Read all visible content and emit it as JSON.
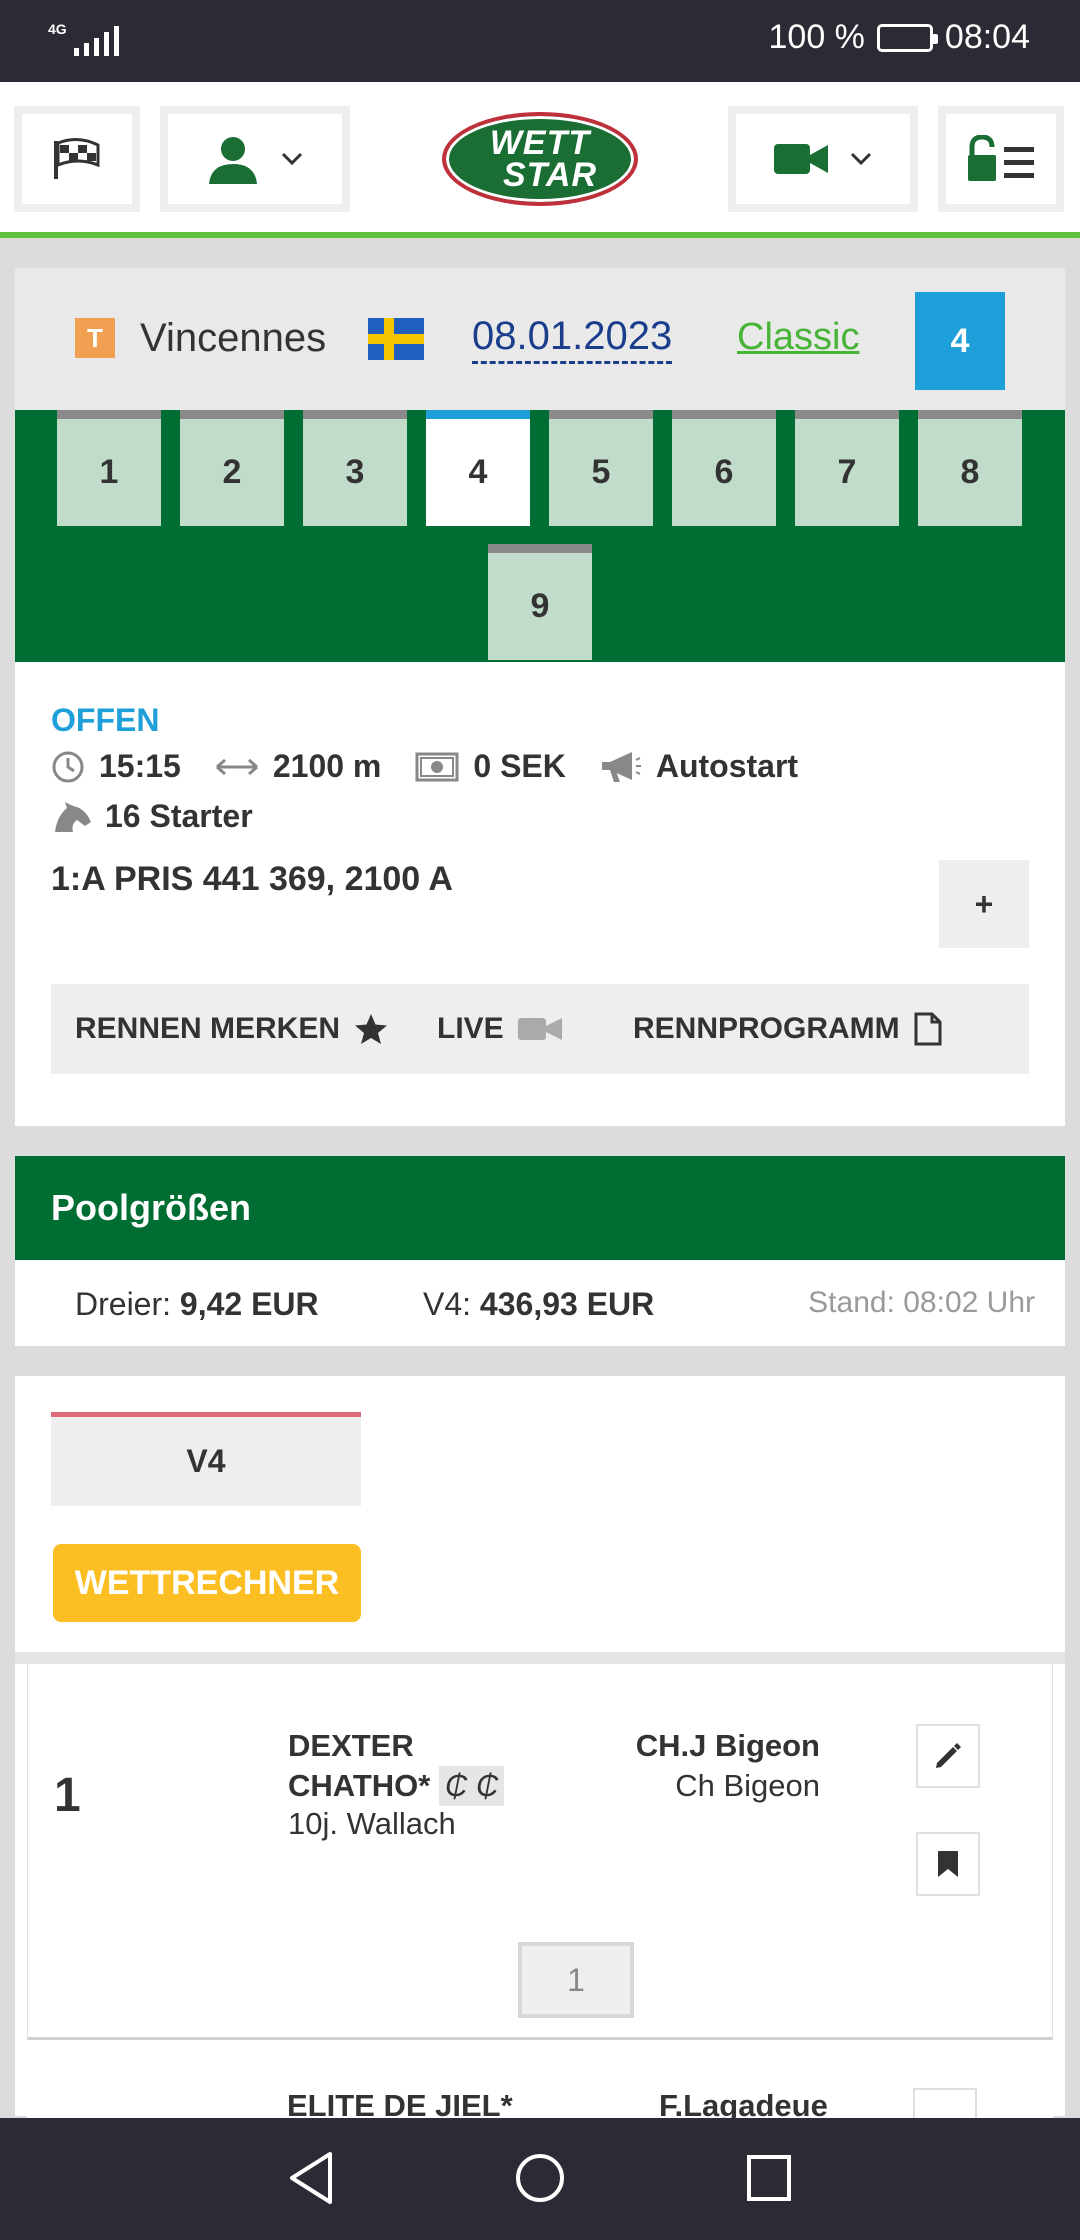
{
  "status_bar": {
    "network": "4G",
    "battery": "100 %",
    "time": "08:04"
  },
  "header": {
    "logo_line1": "WETT",
    "logo_line2": "STAR"
  },
  "race_header": {
    "type_badge": "T",
    "venue": "Vincennes",
    "date": "08.01.2023",
    "mode": "Classic",
    "race_number": "4"
  },
  "race_tabs": [
    "1",
    "2",
    "3",
    "4",
    "5",
    "6",
    "7",
    "8",
    "9"
  ],
  "race_info": {
    "status": "OFFEN",
    "time": "15:15",
    "distance": "2100 m",
    "prize": "0 SEK",
    "start_type": "Autostart",
    "starters": "16 Starter",
    "title": "1:A PRIS 441 369, 2100 A",
    "expand": "+",
    "actions": {
      "bookmark": "RENNEN MERKEN",
      "live": "LIVE",
      "program": "RENNPROGRAMM"
    }
  },
  "pool": {
    "title": "Poolgrößen",
    "dreier_label": "Dreier:",
    "dreier_value": "9,42 EUR",
    "v4_label": "V4:",
    "v4_value": "436,93 EUR",
    "stand": "Stand: 08:02 Uhr"
  },
  "bets": {
    "tab": "V4",
    "calculator": "WETTRECHNER"
  },
  "runners": [
    {
      "number": "1",
      "name_line1": "DEXTER",
      "name_line2": "CHATHO*",
      "marks": "₵ ₵",
      "detail": "10j. Wallach",
      "trainer": "CH.J Bigeon",
      "driver": "Ch Bigeon",
      "selection": "1"
    },
    {
      "name": "ELITE DE JIEL*",
      "driver": "F.Lagadeue"
    }
  ],
  "colors": {
    "green": "#006e33",
    "accent_blue": "#1e9fd9",
    "accent_yellow": "#fbbf24",
    "accent_light_green": "#5fbf3b"
  }
}
